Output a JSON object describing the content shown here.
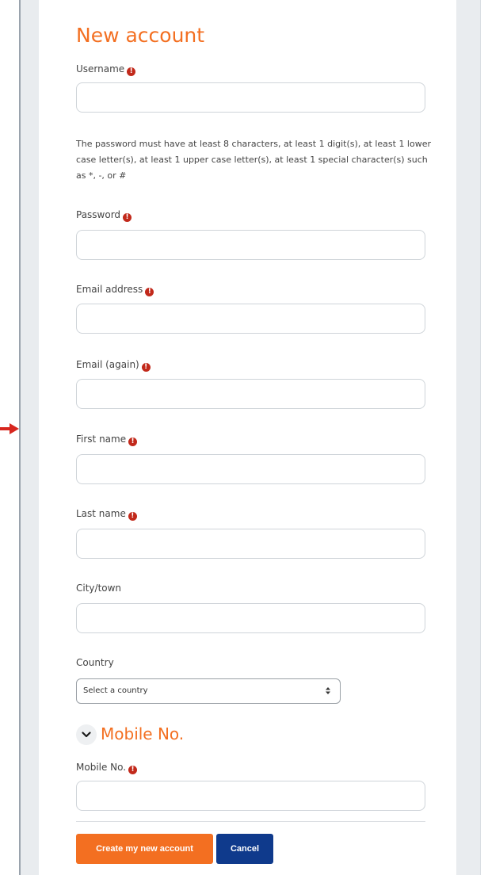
{
  "page": {
    "title": "New account"
  },
  "fields": {
    "username": {
      "label": "Username",
      "value": ""
    },
    "password_policy": "The password must have at least 8 characters, at least 1 digit(s), at least 1 lower case letter(s), at least 1 upper case letter(s), at least 1 special character(s) such as *, -, or #",
    "password": {
      "label": "Password",
      "value": ""
    },
    "email": {
      "label": "Email address",
      "value": ""
    },
    "email_again": {
      "label": "Email (again)",
      "value": ""
    },
    "first_name": {
      "label": "First name",
      "value": ""
    },
    "last_name": {
      "label": "Last name",
      "value": ""
    },
    "city": {
      "label": "City/town",
      "value": ""
    },
    "country": {
      "label": "Country",
      "selected": "Select a country"
    }
  },
  "mobile_section": {
    "title": "Mobile No.",
    "mobile": {
      "label": "Mobile No.",
      "value": ""
    }
  },
  "required_icon": "!",
  "buttons": {
    "create": "Create my new account",
    "cancel": "Cancel"
  },
  "colors": {
    "accent": "#f36f21",
    "secondary_button": "#0f3a8c",
    "required_icon": "#c2291b",
    "annotation_arrow": "#d7261e"
  },
  "icons": {
    "required": "exclamation-circle-icon",
    "section_toggle": "chevron-down-icon",
    "select_caret": "up-down-caret-icon",
    "annotation": "red-arrow-icon"
  }
}
